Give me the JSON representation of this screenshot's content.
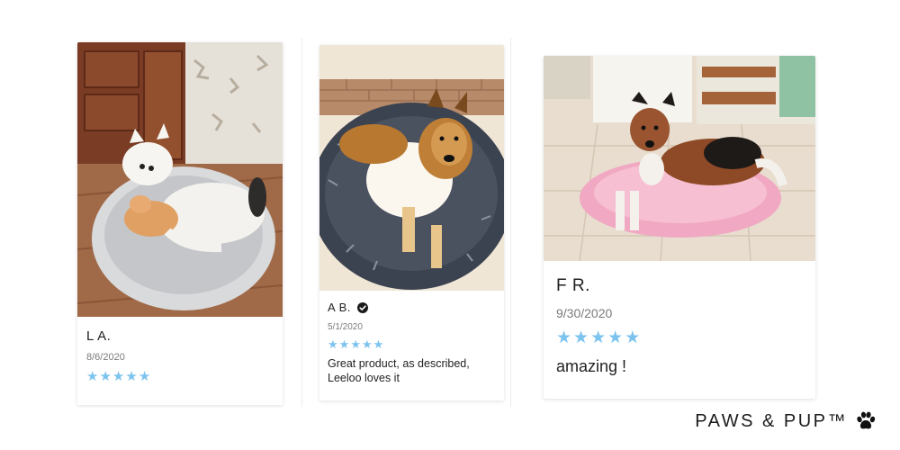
{
  "reviews": [
    {
      "name": "L A.",
      "date": "8/6/2020",
      "rating": 5,
      "stars": "★★★★★",
      "text": "",
      "photo_icon": "dog-photo-white-dog-grey-bed"
    },
    {
      "name": "A B.",
      "date": "5/1/2020",
      "rating": 5,
      "stars": "★★★★★",
      "text": "Great product, as described, Leeloo loves it",
      "verified": true,
      "photo_icon": "dog-photo-sheltie-dark-bed"
    },
    {
      "name": "F R.",
      "date": "9/30/2020",
      "rating": 5,
      "stars": "★★★★★",
      "text": "amazing !",
      "photo_icon": "dog-photo-collie-pink-bed"
    }
  ],
  "brand": {
    "name": "PAWS & PUP™",
    "icon": "paw-print-icon"
  },
  "colors": {
    "star": "#7cc3ee",
    "text": "#222222",
    "date": "#7a7a7a",
    "background": "#ffffff"
  }
}
